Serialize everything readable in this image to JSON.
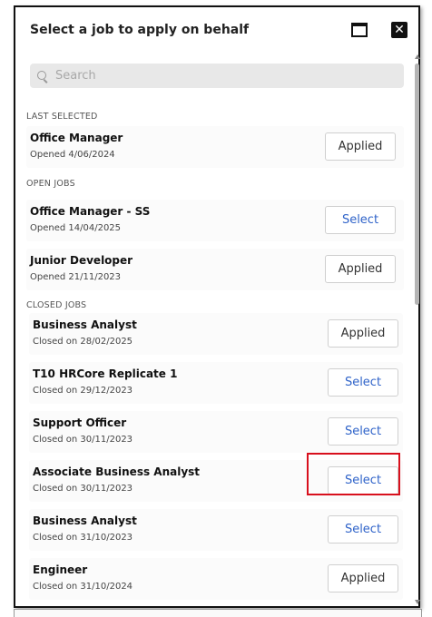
{
  "dialog": {
    "title": "Select a job to apply on behalf",
    "maximize_icon": "maximize-window-icon",
    "close_icon": "close-icon",
    "close_glyph": "✕"
  },
  "search": {
    "placeholder": "Search",
    "value": ""
  },
  "sections": {
    "last_selected": "LAST SELECTED",
    "open_jobs": "OPEN JOBS",
    "closed_jobs": "CLOSED JOBS"
  },
  "jobs": [
    {
      "title": "Office Manager",
      "subtitle": "Opened 4/06/2024",
      "action": "Applied",
      "section": "last_selected"
    },
    {
      "title": "Office Manager - SS",
      "subtitle": "Opened 14/04/2025",
      "action": "Select",
      "section": "open_jobs"
    },
    {
      "title": "Junior Developer",
      "subtitle": "Opened 21/11/2023",
      "action": "Applied",
      "section": "open_jobs"
    },
    {
      "title": "Business Analyst",
      "subtitle": "Closed on 28/02/2025",
      "action": "Applied",
      "section": "closed_jobs"
    },
    {
      "title": "T10 HRCore Replicate 1",
      "subtitle": "Closed on 29/12/2023",
      "action": "Select",
      "section": "closed_jobs"
    },
    {
      "title": "Support Officer",
      "subtitle": "Closed on 30/11/2023",
      "action": "Select",
      "section": "closed_jobs"
    },
    {
      "title": "Associate Business Analyst",
      "subtitle": "Closed on 30/11/2023",
      "action": "Select",
      "section": "closed_jobs",
      "highlighted": true
    },
    {
      "title": "Business Analyst",
      "subtitle": "Closed on 31/10/2023",
      "action": "Select",
      "section": "closed_jobs"
    },
    {
      "title": "Engineer",
      "subtitle": "Closed on 31/10/2024",
      "action": "Applied",
      "section": "closed_jobs"
    }
  ],
  "colors": {
    "select_text": "#2f63c9",
    "highlight_border": "#d8101d",
    "search_background": "#e8e8e8"
  }
}
